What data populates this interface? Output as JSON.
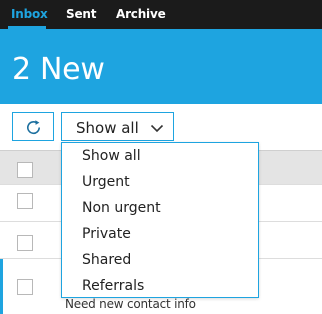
{
  "nav": {
    "tabs": [
      {
        "label": "Inbox",
        "active": true
      },
      {
        "label": "Sent",
        "active": false
      },
      {
        "label": "Archive",
        "active": false
      }
    ]
  },
  "banner": {
    "title": "2 New"
  },
  "toolbar": {
    "refresh_icon": "refresh-icon",
    "filter": {
      "selected": "Show all",
      "options": [
        "Show all",
        "Urgent",
        "Non urgent",
        "Private",
        "Shared",
        "Referrals"
      ]
    }
  },
  "messages": {
    "rows": [
      {
        "text": ""
      },
      {
        "text": ""
      },
      {
        "text": "Need new contact info"
      }
    ]
  },
  "colors": {
    "accent": "#1ea4e0",
    "nav_bg": "#1b1b1b",
    "header_row_bg": "#e4e4e4"
  }
}
